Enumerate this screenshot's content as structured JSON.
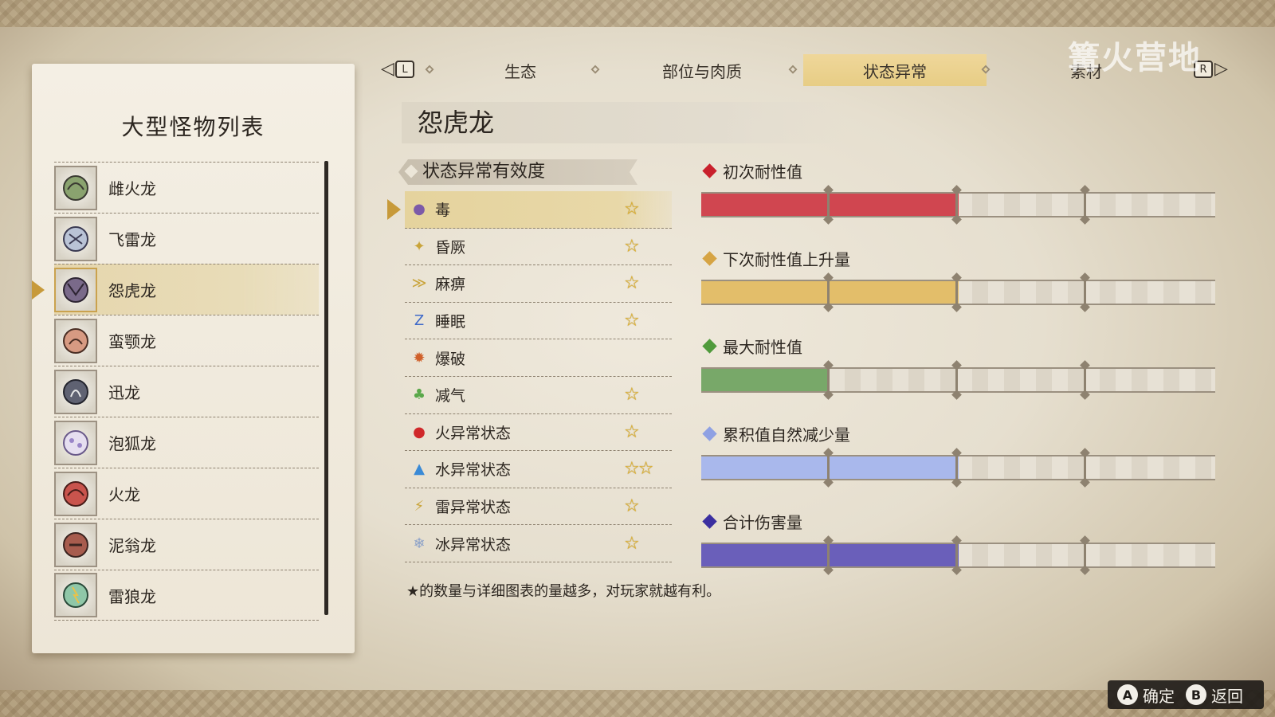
{
  "left_panel": {
    "title": "大型怪物列表",
    "monsters": [
      {
        "name": "雌火龙",
        "icon": "rathian-icon",
        "selected": false
      },
      {
        "name": "飞雷龙",
        "icon": "tobi-kadachi-icon",
        "selected": false
      },
      {
        "name": "怨虎龙",
        "icon": "magnamalo-icon",
        "selected": true
      },
      {
        "name": "蛮颚龙",
        "icon": "anjanath-icon",
        "selected": false
      },
      {
        "name": "迅龙",
        "icon": "nargacuga-icon",
        "selected": false
      },
      {
        "name": "泡狐龙",
        "icon": "mizutsune-icon",
        "selected": false
      },
      {
        "name": "火龙",
        "icon": "rathalos-icon",
        "selected": false
      },
      {
        "name": "泥翁龙",
        "icon": "almudron-icon",
        "selected": false
      },
      {
        "name": "雷狼龙",
        "icon": "zinogre-icon",
        "selected": false
      }
    ]
  },
  "tabs": {
    "left_button": "L",
    "right_button": "R",
    "items": [
      {
        "label": "生态",
        "active": false
      },
      {
        "label": "部位与肉质",
        "active": false
      },
      {
        "label": "状态异常",
        "active": true
      },
      {
        "label": "素材",
        "active": false
      }
    ]
  },
  "watermark": "篝火营地",
  "monster_title": "怨虎龙",
  "effectiveness": {
    "header": "状态异常有效度",
    "rows": [
      {
        "label": "毒",
        "icon": "poison-icon",
        "stars": "☆",
        "selected": true
      },
      {
        "label": "昏厥",
        "icon": "stun-icon",
        "stars": "☆",
        "selected": false
      },
      {
        "label": "麻痹",
        "icon": "paralysis-icon",
        "stars": "☆",
        "selected": false
      },
      {
        "label": "睡眠",
        "icon": "sleep-icon",
        "stars": "☆",
        "selected": false
      },
      {
        "label": "爆破",
        "icon": "blast-icon",
        "stars": "",
        "selected": false
      },
      {
        "label": "减气",
        "icon": "exhaust-icon",
        "stars": "☆",
        "selected": false
      },
      {
        "label": "火异常状态",
        "icon": "fireblight-icon",
        "stars": "☆",
        "selected": false
      },
      {
        "label": "水异常状态",
        "icon": "waterblight-icon",
        "stars": "☆☆",
        "selected": false
      },
      {
        "label": "雷异常状态",
        "icon": "thunderblight-icon",
        "stars": "☆",
        "selected": false
      },
      {
        "label": "冰异常状态",
        "icon": "iceblight-icon",
        "stars": "☆",
        "selected": false
      }
    ],
    "footnote": "★的数量与详细图表的量越多，对玩家就越有利。"
  },
  "stats": [
    {
      "label": "初次耐性值",
      "color": "#d04650",
      "diamond": "#c9202c",
      "level": 0.5
    },
    {
      "label": "下次耐性值上升量",
      "color": "#e3be6a",
      "diamond": "#d6a444",
      "level": 0.5
    },
    {
      "label": "最大耐性值",
      "color": "#78a869",
      "diamond": "#4f9a3b",
      "level": 0.25
    },
    {
      "label": "累积值自然减少量",
      "color": "#a9b8ec",
      "diamond": "#8fa1e3",
      "level": 0.5
    },
    {
      "label": "合计伤害量",
      "color": "#6a5fba",
      "diamond": "#3b2fa0",
      "level": 0.5
    }
  ],
  "hints": [
    {
      "button": "A",
      "label": "确定"
    },
    {
      "button": "B",
      "label": "返回"
    }
  ]
}
